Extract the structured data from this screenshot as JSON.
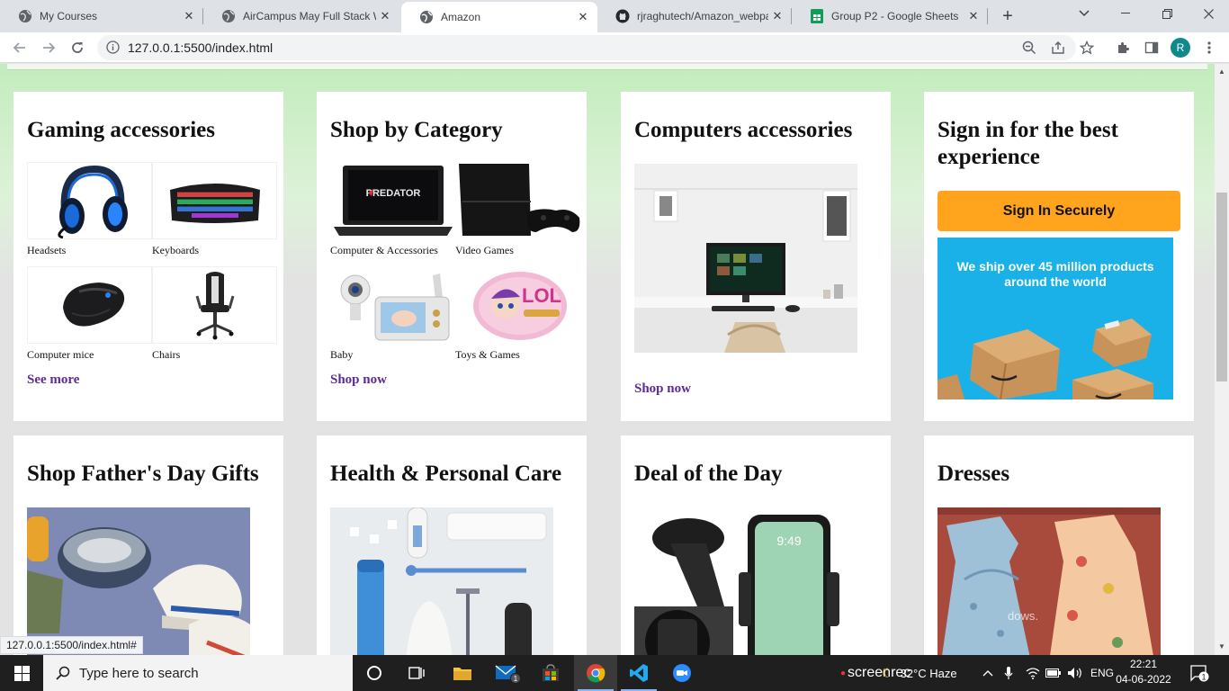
{
  "browser": {
    "tabs": [
      {
        "title": "My Courses",
        "icon": "globe-icon",
        "active": false
      },
      {
        "title": "AirCampus May Full Stack Web",
        "icon": "globe-icon",
        "active": false
      },
      {
        "title": "Amazon",
        "icon": "globe-icon",
        "active": true
      },
      {
        "title": "rjraghutech/Amazon_webpage",
        "icon": "github-icon",
        "active": false
      },
      {
        "title": "Group P2 - Google Sheets",
        "icon": "sheets-icon",
        "active": false
      }
    ],
    "url": "127.0.0.1:5500/index.html",
    "profile_initial": "R",
    "status_url": "127.0.0.1:5500/index.html#"
  },
  "cards": [
    {
      "title": "Gaming accessories",
      "items": [
        {
          "label": "Headsets",
          "icon": "headset-icon"
        },
        {
          "label": "Keyboards",
          "icon": "keyboard-icon"
        },
        {
          "label": "Computer mice",
          "icon": "mouse-icon"
        },
        {
          "label": "Chairs",
          "icon": "chair-icon"
        }
      ],
      "link": "See more"
    },
    {
      "title": "Shop by Category",
      "items": [
        {
          "label": "Computer & Accessories",
          "icon": "laptop-icon"
        },
        {
          "label": "Video Games",
          "icon": "console-icon"
        },
        {
          "label": "Baby",
          "icon": "baby-monitor-icon"
        },
        {
          "label": "Toys & Games",
          "icon": "toy-ball-icon"
        }
      ],
      "link": "Shop now"
    },
    {
      "title": "Computers accessories",
      "image": "desktop-computer-image",
      "link": "Shop now"
    },
    {
      "title": "Sign in for the best experience",
      "button": "Sign In Securely",
      "banner_text": "We ship over 45 million products around the world"
    },
    {
      "title": "Shop Father's Day Gifts",
      "image": "fathers-day-image"
    },
    {
      "title": "Health & Personal Care",
      "image": "personal-care-image"
    },
    {
      "title": "Deal of the Day",
      "image": "phone-holder-image"
    },
    {
      "title": "Dresses",
      "image": "dresses-image"
    }
  ],
  "taskbar": {
    "search_placeholder": "Type here to search",
    "weather": "32°C  Haze",
    "language": "ENG",
    "time": "22:21",
    "date": "04-06-2022",
    "notifications": "1",
    "recorder": "screenrec"
  },
  "colors": {
    "hero_green": "#c3ecbd",
    "signin_button": "#ffa41c",
    "link_purple": "#5c2d91",
    "ship_banner": "#1ab1e8"
  }
}
